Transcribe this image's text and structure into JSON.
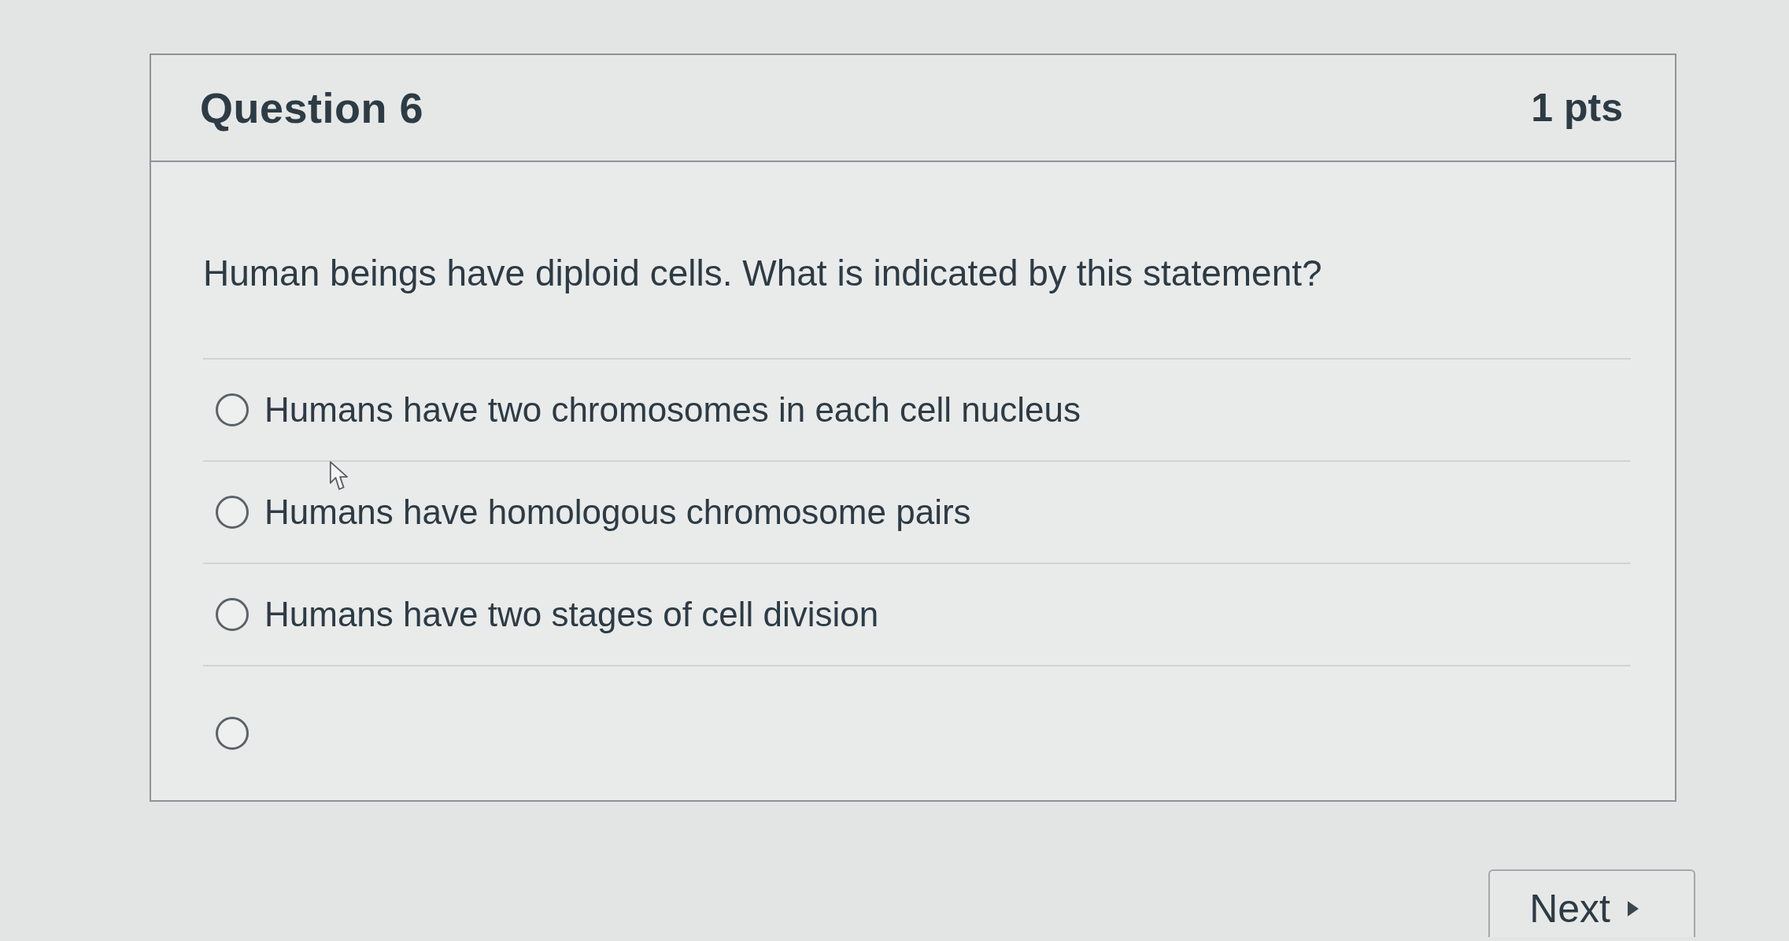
{
  "question": {
    "title": "Question 6",
    "points": "1 pts",
    "prompt": "Human beings have diploid cells. What is indicated by this statement?",
    "answers": [
      {
        "label": "Humans have two chromosomes in each cell nucleus",
        "selected": false
      },
      {
        "label": "Humans have homologous chromosome pairs",
        "selected": false
      },
      {
        "label": "Humans have two stages of cell division",
        "selected": false
      },
      {
        "selected": false
      }
    ]
  },
  "navigation": {
    "next_button": "Next"
  }
}
